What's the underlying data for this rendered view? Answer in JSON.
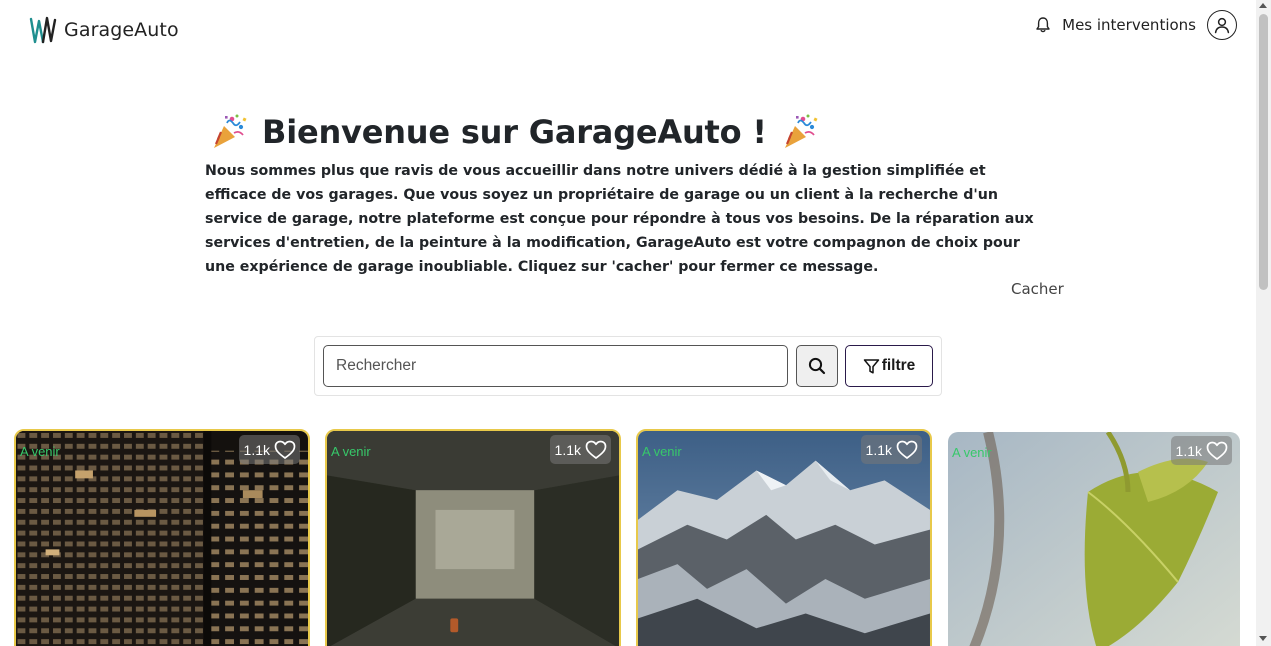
{
  "header": {
    "brand_name": "GarageAuto",
    "nav_interventions": "Mes interventions"
  },
  "welcome": {
    "title": "Bienvenue sur GarageAuto !",
    "text": "Nous sommes plus que ravis de vous accueillir dans notre univers dédié à la gestion simplifiée et efficace de vos garages. Que vous soyez un propriétaire de garage ou un client à la recherche d'un service de garage, notre plateforme est conçue pour répondre à tous vos besoins. De la réparation aux services d'entretien, de la peinture à la modification, GarageAuto est votre compagnon de choix pour une expérience de garage inoubliable. Cliquez sur 'cacher' pour fermer ce message.",
    "hide_label": "Cacher"
  },
  "search": {
    "placeholder": "Rechercher",
    "filter_label": "filtre"
  },
  "cards": [
    {
      "status": "A venir",
      "likes": "1.1k"
    },
    {
      "status": "A venir",
      "likes": "1.1k"
    },
    {
      "status": "A venir",
      "likes": "1.1k"
    },
    {
      "status": "A venir",
      "likes": "1.1k"
    }
  ],
  "colors": {
    "status_green": "#37c86a",
    "card_border": "#e8c94a",
    "brand_teal": "#1f8f8f",
    "filter_border": "#2a1a4a"
  },
  "icons": {
    "logo": "garageauto-logo-icon",
    "bell": "bell-icon",
    "user": "user-icon",
    "party": "party-popper-icon",
    "search": "search-icon",
    "filter": "filter-icon",
    "heart": "heart-icon"
  }
}
